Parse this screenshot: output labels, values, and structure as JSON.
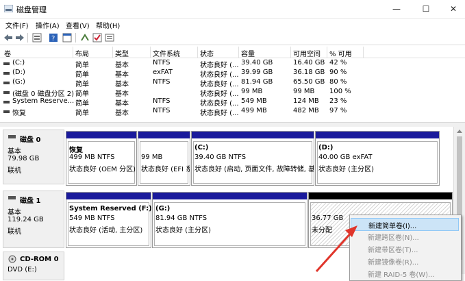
{
  "window": {
    "title": "磁盘管理",
    "controls": {
      "minimize": "—",
      "maximize": "☐",
      "close": "✕"
    }
  },
  "menu": [
    "文件(F)",
    "操作(A)",
    "查看(V)",
    "帮助(H)"
  ],
  "toolbar": [
    "back-icon",
    "forward-icon",
    "properties-icon",
    "help-icon",
    "console-icon",
    "connect-icon",
    "check-icon",
    "list-icon"
  ],
  "volume_table": {
    "headers": [
      "卷",
      "布局",
      "类型",
      "文件系统",
      "状态",
      "容量",
      "可用空间",
      "% 可用"
    ],
    "rows": [
      [
        "(C:)",
        "简单",
        "基本",
        "NTFS",
        "状态良好 (...",
        "39.40 GB",
        "16.40 GB",
        "42 %"
      ],
      [
        "(D:)",
        "简单",
        "基本",
        "exFAT",
        "状态良好 (...",
        "39.99 GB",
        "36.18 GB",
        "90 %"
      ],
      [
        "(G:)",
        "简单",
        "基本",
        "NTFS",
        "状态良好 (...",
        "81.94 GB",
        "65.50 GB",
        "80 %"
      ],
      [
        "(磁盘 0 磁盘分区 2)",
        "简单",
        "基本",
        "",
        "状态良好 (...",
        "99 MB",
        "99 MB",
        "100 %"
      ],
      [
        "System Reserve...",
        "简单",
        "基本",
        "NTFS",
        "状态良好 (...",
        "549 MB",
        "124 MB",
        "23 %"
      ],
      [
        "恢复",
        "简单",
        "基本",
        "NTFS",
        "状态良好 (...",
        "499 MB",
        "482 MB",
        "97 %"
      ]
    ]
  },
  "disks": [
    {
      "name": "磁盘 0",
      "type": "基本",
      "size": "79.98 GB",
      "status": "联机",
      "partitions": [
        {
          "label": "恢复",
          "size": "499 MB NTFS",
          "status": "状态良好 (OEM 分区)"
        },
        {
          "label": "",
          "size": "99 MB",
          "status": "状态良好 (EFI 系"
        },
        {
          "label": "(C:)",
          "size": "39.40 GB NTFS",
          "status": "状态良好 (启动, 页面文件, 故障转储, 基"
        },
        {
          "label": "(D:)",
          "size": "40.00 GB exFAT",
          "status": "状态良好 (主分区)"
        }
      ]
    },
    {
      "name": "磁盘 1",
      "type": "基本",
      "size": "119.24 GB",
      "status": "联机",
      "partitions": [
        {
          "label": "System Reserved  (F:)",
          "size": "549 MB NTFS",
          "status": "状态良好 (活动, 主分区)"
        },
        {
          "label": "(G:)",
          "size": "81.94 GB NTFS",
          "status": "状态良好 (主分区)"
        },
        {
          "label": "",
          "size": "36.77 GB",
          "status": "未分配"
        }
      ]
    },
    {
      "name": "CD-ROM 0",
      "type": "DVD (E:)"
    }
  ],
  "context_menu": [
    {
      "label": "新建简单卷(I)...",
      "enabled": true
    },
    {
      "label": "新建跨区卷(N)...",
      "enabled": false
    },
    {
      "label": "新建带区卷(T)...",
      "enabled": false
    },
    {
      "label": "新建镜像卷(R)...",
      "enabled": false
    },
    {
      "label": "新建 RAID-5 卷(W)...",
      "enabled": false
    }
  ],
  "colors": {
    "partition_header": "#1a1a9c",
    "unallocated_header": "#000000",
    "menu_highlight": "#cce4f7",
    "annotation_arrow": "#e0352b"
  }
}
